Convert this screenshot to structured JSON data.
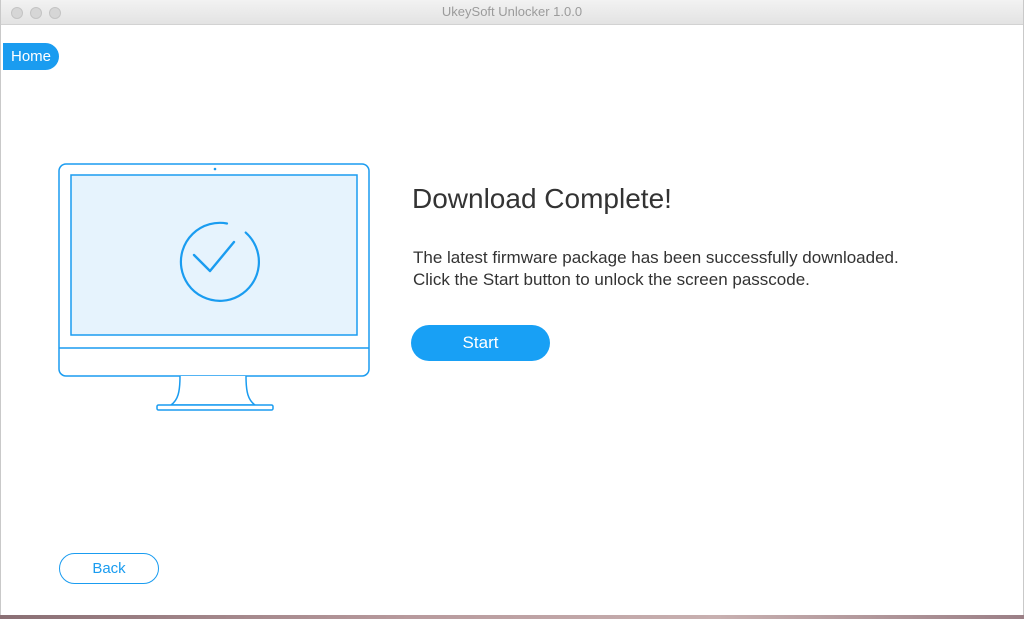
{
  "window": {
    "title": "UkeySoft Unlocker 1.0.0"
  },
  "nav": {
    "home_label": "Home"
  },
  "illustration": {
    "icon": "monitor-checkmark-icon",
    "accent_color": "#1a9cf0",
    "screen_fill": "#e6f3fd"
  },
  "main": {
    "headline": "Download Complete!",
    "description_line1": "The latest firmware package has been successfully downloaded.",
    "description_line2": "Click the Start button to unlock the screen passcode.",
    "start_label": "Start"
  },
  "footer": {
    "back_label": "Back"
  },
  "colors": {
    "primary": "#1a9cf0",
    "text": "#333333",
    "titlebar_text": "#9b9b9b"
  }
}
